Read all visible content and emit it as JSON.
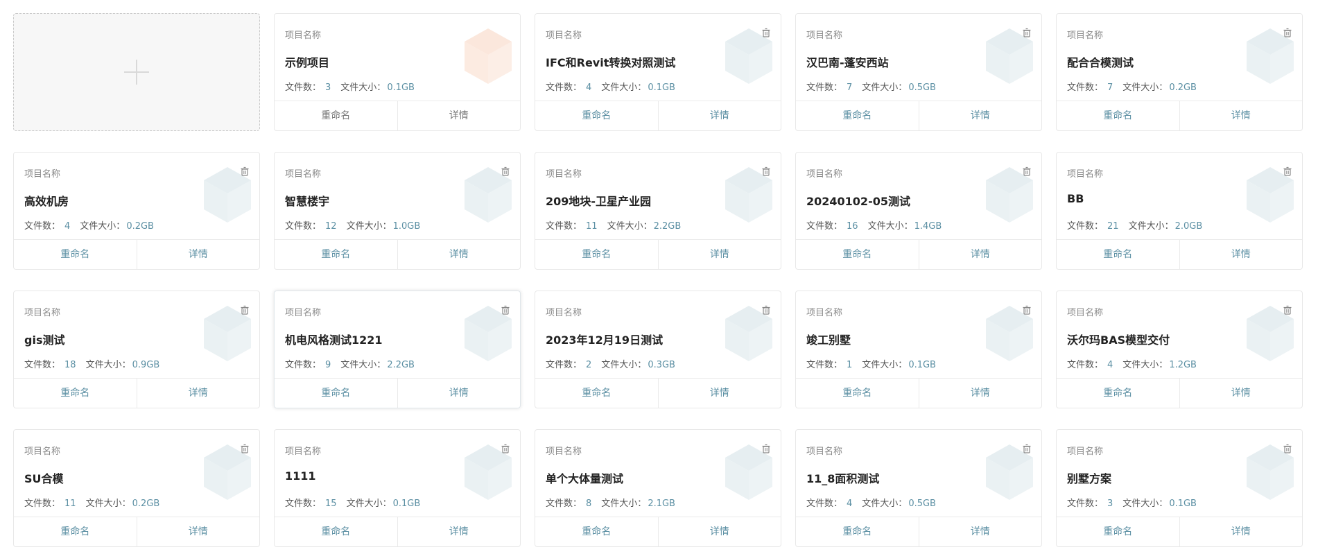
{
  "labels": {
    "project_name": "项目名称",
    "file_count": "文件数：",
    "file_size": "文件大小：",
    "rename": "重命名",
    "details": "详情"
  },
  "icons": {
    "add": "plus-icon",
    "delete": "trash-icon",
    "thumbnail": "cube-icon"
  },
  "colors": {
    "accent": "#5b8fa3",
    "cube_default": "#e6eef1",
    "cube_sample": "#fbe7dc"
  },
  "projects": [
    {
      "name": "示例项目",
      "files": "3",
      "size": "0.1GB",
      "sample": true
    },
    {
      "name": "IFC和Revit转换对照测试",
      "files": "4",
      "size": "0.1GB"
    },
    {
      "name": "汉巴南-蓬安西站",
      "files": "7",
      "size": "0.5GB"
    },
    {
      "name": "配合合模测试",
      "files": "7",
      "size": "0.2GB"
    },
    {
      "name": "高效机房",
      "files": "4",
      "size": "0.2GB"
    },
    {
      "name": "智慧楼宇",
      "files": "12",
      "size": "1.0GB"
    },
    {
      "name": "209地块-卫星产业园",
      "files": "11",
      "size": "2.2GB"
    },
    {
      "name": "20240102-05测试",
      "files": "16",
      "size": "1.4GB"
    },
    {
      "name": "BB",
      "files": "21",
      "size": "2.0GB"
    },
    {
      "name": "gis测试",
      "files": "18",
      "size": "0.9GB"
    },
    {
      "name": "机电风格测试1221",
      "files": "9",
      "size": "2.2GB",
      "hover": true
    },
    {
      "name": "2023年12月19日测试",
      "files": "2",
      "size": "0.3GB"
    },
    {
      "name": "竣工别墅",
      "files": "1",
      "size": "0.1GB"
    },
    {
      "name": "沃尔玛BAS模型交付",
      "files": "4",
      "size": "1.2GB"
    },
    {
      "name": "SU合模",
      "files": "11",
      "size": "0.2GB"
    },
    {
      "name": "1111",
      "files": "15",
      "size": "0.1GB"
    },
    {
      "name": "单个大体量测试",
      "files": "8",
      "size": "2.1GB"
    },
    {
      "name": "11_8面积测试",
      "files": "4",
      "size": "0.5GB"
    },
    {
      "name": "别墅方案",
      "files": "3",
      "size": "0.1GB"
    }
  ]
}
